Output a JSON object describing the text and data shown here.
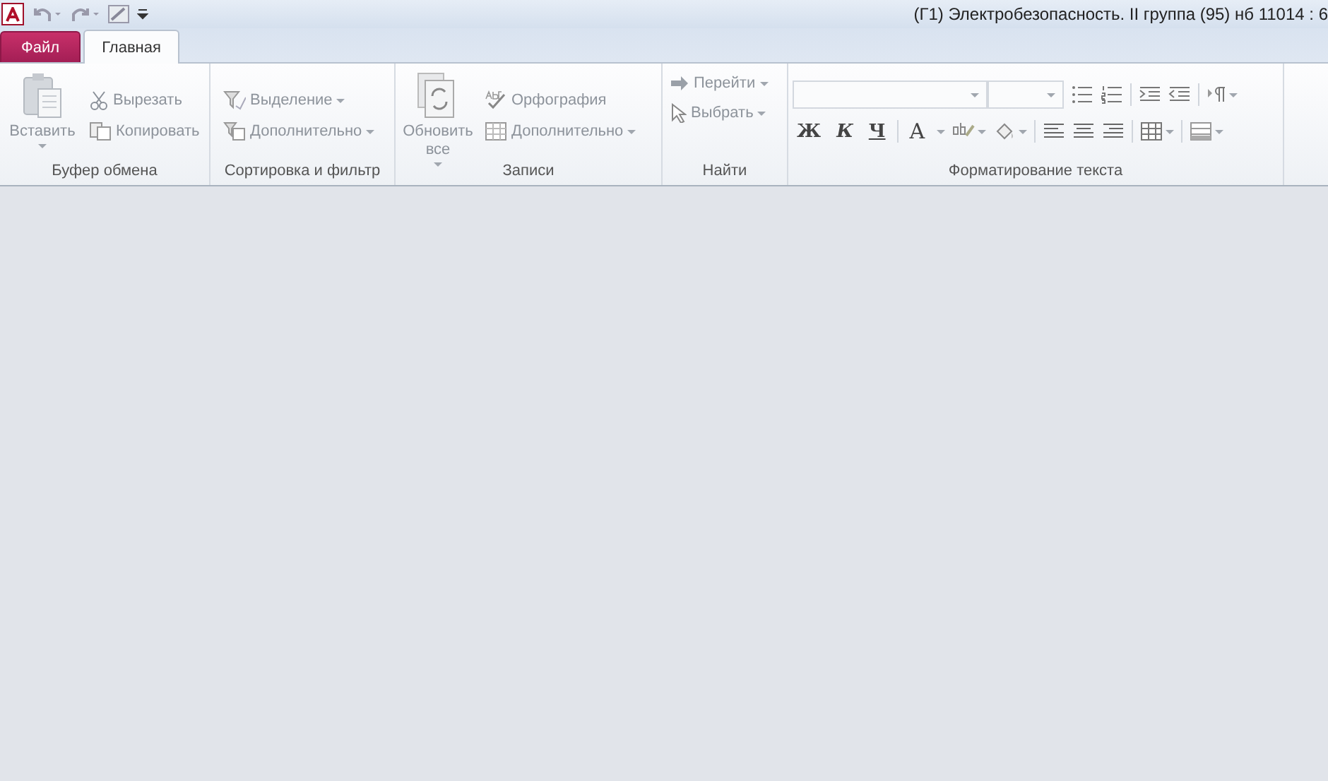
{
  "title_bar": {
    "title": "(Г1) Электробезопасность. II группа (95) нб 11014 : 6"
  },
  "tabs": [
    {
      "label": "Файл",
      "kind": "file",
      "selected": false
    },
    {
      "label": "Главная",
      "kind": "normal",
      "selected": true
    }
  ],
  "groups": [
    {
      "kind": "clipboard",
      "label": "Буфер обмена",
      "commands": [
        {
          "label": "Вставить",
          "dropdown": true,
          "disabled": true
        },
        {
          "label": "Вырезать",
          "dropdown": false,
          "disabled": true
        },
        {
          "label": "Копировать",
          "dropdown": false,
          "disabled": true
        }
      ]
    },
    {
      "kind": "sort",
      "label": "Сортировка и фильтр",
      "commands": [
        {
          "label": "Выделение",
          "dropdown": true,
          "disabled": true
        },
        {
          "label": "Дополнительно",
          "dropdown": true,
          "disabled": true
        }
      ]
    },
    {
      "kind": "records",
      "label": "Записи",
      "commands": [
        {
          "label": "Обновить все",
          "dropdown": true,
          "disabled": true
        },
        {
          "label": "Орфография",
          "dropdown": false,
          "disabled": true
        },
        {
          "label": "Дополнительно",
          "dropdown": true,
          "disabled": true
        }
      ]
    },
    {
      "kind": "find",
      "label": "Найти",
      "commands": [
        {
          "label": "Перейти",
          "dropdown": true,
          "disabled": true
        },
        {
          "label": "Выбрать",
          "dropdown": true,
          "disabled": true
        }
      ]
    },
    {
      "kind": "format",
      "label": "Форматирование текста",
      "bold": "Ж",
      "italic": "К",
      "underline": "Ч",
      "font_color": "A"
    }
  ]
}
